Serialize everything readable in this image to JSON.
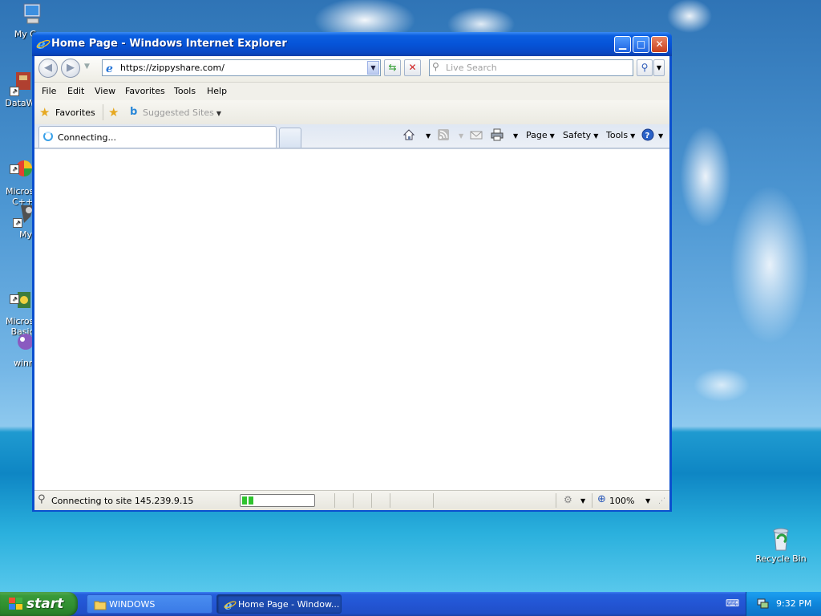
{
  "desktop": {
    "icons": [
      {
        "label": "My Com"
      },
      {
        "label": "DataWa"
      },
      {
        "label": "Microso\nC++"
      },
      {
        "label": "My"
      },
      {
        "label": "Microso\nBasic"
      },
      {
        "label": "winn"
      }
    ],
    "recycle_bin": "Recycle Bin"
  },
  "window": {
    "title": "Home Page - Windows Internet Explorer",
    "address": "https://zippyshare.com/",
    "search_placeholder": "Live Search",
    "menu": [
      "File",
      "Edit",
      "View",
      "Favorites",
      "Tools",
      "Help"
    ],
    "favorites_label": "Favorites",
    "suggested_sites": "Suggested Sites",
    "tab_label": "Connecting...",
    "commands": {
      "page": "Page",
      "safety": "Safety",
      "tools": "Tools"
    },
    "status_text": "Connecting to site 145.239.9.15",
    "progress": 0.18,
    "zoom": "100%"
  },
  "taskbar": {
    "start": "start",
    "buttons": [
      {
        "label": "WINDOWS"
      },
      {
        "label": "Home Page - Window..."
      }
    ],
    "clock": "9:32 PM"
  },
  "colors": {
    "titlebar": "#0654d8",
    "taskbar": "#2355d4",
    "start": "#2f8f2f",
    "progress": "#2fc32f"
  }
}
